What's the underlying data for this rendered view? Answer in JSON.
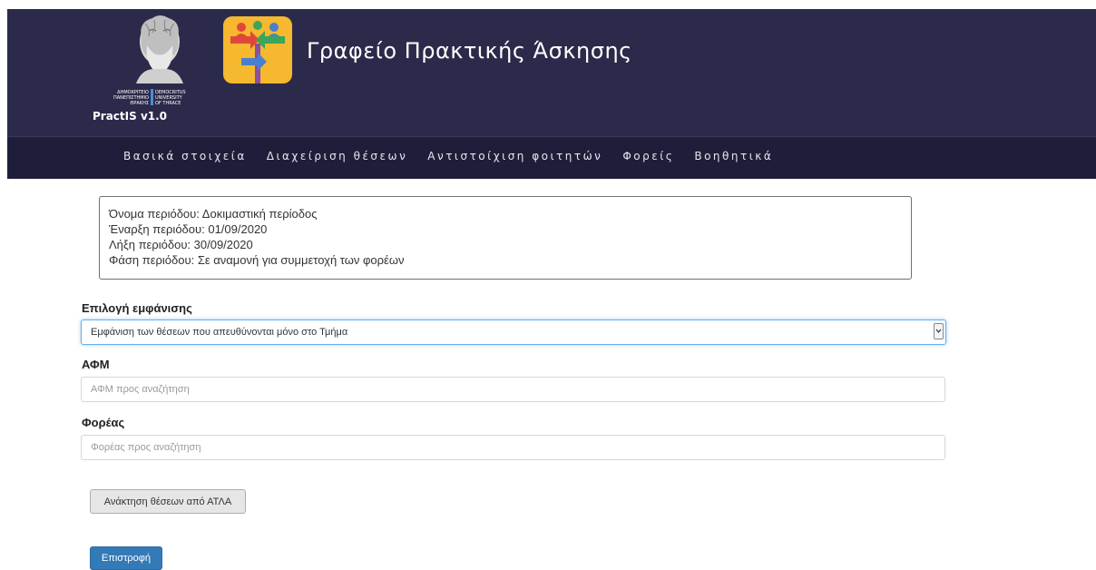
{
  "header": {
    "title": "Γραφείο Πρακτικής Άσκησης",
    "version": "PractIS v1.0",
    "university_logo": {
      "icon": "university-logo-icon",
      "text_el": "ΔΗΜΟΚΡΙΤΕΙΟ ΠΑΝΕΠΙΣΤΗΜΙΟ ΘΡΑΚΗΣ",
      "text_en": "DEMOCRITUS UNIVERSITY OF THRACE"
    },
    "app_logo_icon": "signpost-people-icon",
    "colors": {
      "header_bg": "#2b2a4a",
      "nav_bg": "#1f1e3a",
      "app_logo_bg": "#f5b82e"
    }
  },
  "nav": {
    "items": [
      {
        "label": "Βασικά στοιχεία"
      },
      {
        "label": "Διαχείριση θέσεων"
      },
      {
        "label": "Αντιστοίχιση φοιτητών"
      },
      {
        "label": "Φορείς"
      },
      {
        "label": "Βοηθητικά"
      }
    ]
  },
  "period": {
    "name": "Όνομα περιόδου: Δοκιμαστική περίοδος",
    "start": "Έναρξη περιόδου: 01/09/2020",
    "end": "Λήξη περιόδου: 30/09/2020",
    "phase": "Φάση περιόδου: Σε αναμονή για συμμετοχή των φορέων"
  },
  "form": {
    "display_label": "Επιλογή εμφάνισης",
    "display_selected": "Εμφάνιση των θέσεων που απευθύνονται μόνο στο Τμήμα",
    "afm_label": "ΑΦΜ",
    "afm_placeholder": "ΑΦΜ προς αναζήτηση",
    "afm_value": "",
    "foreas_label": "Φορέας",
    "foreas_placeholder": "Φορέας προς αναζήτηση",
    "foreas_value": ""
  },
  "buttons": {
    "atla": "Ανάκτηση θέσεων από ΑΤΛΑ",
    "back": "Επιστροφή",
    "back_color": "#337ab7"
  }
}
